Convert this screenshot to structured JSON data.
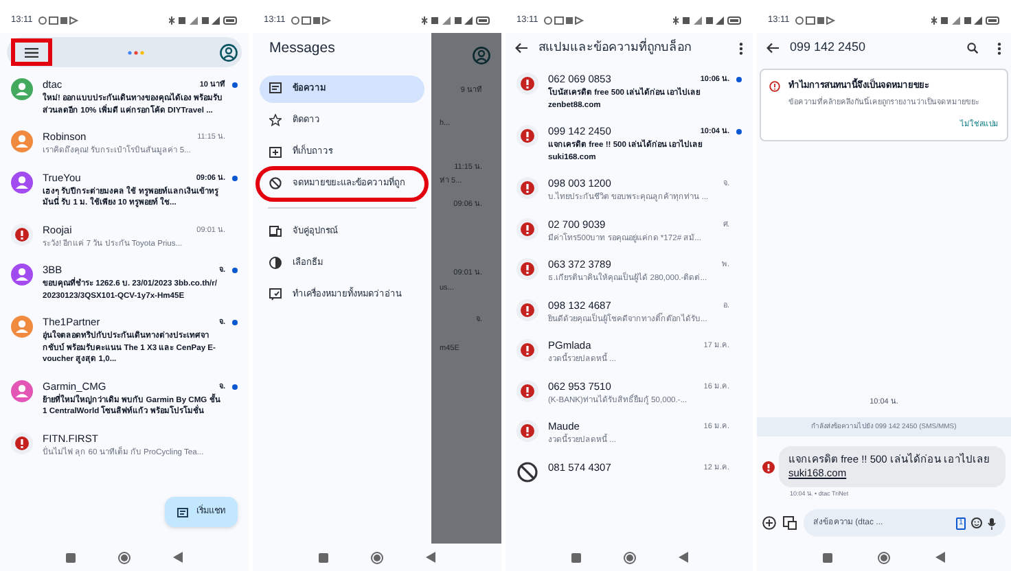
{
  "panels": [
    {
      "kind": "inbox",
      "status_time": "13:11",
      "menu_highlighted": true,
      "conversations": [
        {
          "name": "dtac",
          "preview": "ใหม่! ออกแบบประกันเดินทางของคุณได้เอง พร้อมรับส่วนลดอีก 10% เพิ่มดี แค่กรอกโค้ด DIYTravel ...",
          "time": "10 นาที",
          "unread": true,
          "avatar": {
            "kind": "person",
            "color": "#43a95c"
          }
        },
        {
          "name": "Robinson",
          "preview": "เราคิดถึงคุณ! รับกระเป๋าโรบินสันมูลค่า 5...",
          "time": "11:15 น.",
          "unread": false,
          "avatar": {
            "kind": "person",
            "color": "#f08a3e"
          }
        },
        {
          "name": "TrueYou",
          "preview": "เฮงๆ รับปีกระต่ายมงคล ใช้ ทรูพอยท์แลกเงินเข้าทรูมันนี่ รับ 1 ม. ใช้เพียง 10 ทรูพอยท์ ใช...",
          "time": "09:06 น.",
          "unread": true,
          "avatar": {
            "kind": "person",
            "color": "#a24bf0"
          }
        },
        {
          "name": "Roojai",
          "preview": "ระวัง! อีกแค่ 7 วัน ประกัน Toyota Prius...",
          "time": "09:01 น.",
          "unread": false,
          "avatar": {
            "kind": "spam"
          }
        },
        {
          "name": "3BB",
          "preview": "ขอบคุณที่ชำระ 1262.6 บ. 23/01/2023 3bb.co.th/r/ 20230123/3QSX101-QCV-1y7x-Hm45E",
          "time": "จ.",
          "unread": true,
          "avatar": {
            "kind": "person",
            "color": "#a24bf0"
          }
        },
        {
          "name": "The1Partner",
          "preview": "อุ่นใจตลอดทริปกับประกันเดินทางต่างประเทศจากชับบ์ พร้อมรับคะแนน The 1 X3 และ CenPay E-voucher สูงสุด 1,0...",
          "time": "จ.",
          "unread": true,
          "avatar": {
            "kind": "person",
            "color": "#f08a3e"
          }
        },
        {
          "name": "Garmin_CMG",
          "preview": "ย้ายที่ใหม่ใหญ่กว่าเดิม พบกับ Garmin By CMG ชั้น 1 CentralWorld โซนลิฟท์แก้ว พร้อมโปรโมชั่น",
          "time": "จ.",
          "unread": true,
          "avatar": {
            "kind": "person",
            "color": "#e356b6"
          }
        },
        {
          "name": "FITN.FIRST",
          "preview": "ปั่นไม่ไฟ ลุก 60 นาทีเต็ม กับ ProCycling Tea...",
          "unread": false,
          "avatar": {
            "kind": "spam"
          }
        }
      ],
      "fab": "เริ่มแชท"
    },
    {
      "kind": "drawer",
      "status_time": "13:11",
      "title": "Messages",
      "items": [
        {
          "label": "ข้อความ",
          "selected": true,
          "highlighted": false
        },
        {
          "label": "ติดดาว",
          "selected": false,
          "highlighted": false
        },
        {
          "label": "ที่เก็บถาวร",
          "selected": false,
          "highlighted": false
        },
        {
          "label": "จดหมายขยะและข้อความที่ถูก",
          "selected": false,
          "highlighted": true
        }
      ],
      "more_items": [
        {
          "label": "จับคู่อุปกรณ์"
        },
        {
          "label": "เลือกธีม"
        },
        {
          "label": "ทำเครื่องหมายทั้งหมดว่าอ่าน"
        }
      ],
      "behind": [
        "9 นาที",
        "h...",
        "11:15 น.",
        "ห่า 5...",
        "09:06 น.",
        "09:01 น.",
        "us...",
        "จ.",
        "m45E"
      ]
    },
    {
      "kind": "spam_list",
      "status_time": "13:11",
      "title": "สแปมและข้อความที่ถูกบล็อก",
      "conversations": [
        {
          "name": "062 069 0853",
          "preview": "โบนัสเครดิต free 500 เล่นได้ก่อน เอาไปเลย zenbet88.com",
          "time": "10:06 น.",
          "unread": true,
          "avatar": {
            "kind": "spam"
          }
        },
        {
          "name": "099 142 2450",
          "preview": "แจกเครดิต free !! 500 เล่นได้ก่อน เอาไปเลย suki168.com",
          "time": "10:04 น.",
          "unread": true,
          "avatar": {
            "kind": "spam"
          }
        },
        {
          "name": "098 003 1200",
          "preview": "บ.ไทยประกันชีวิต ขอบพระคุณลูกค้าทุกท่าน ...",
          "time": "จ.",
          "unread": false,
          "avatar": {
            "kind": "spam"
          }
        },
        {
          "name": "02 700 9039",
          "preview": "มีค่าโทร500บาท รอคุณอยู่แค่กด *172# สมั...",
          "time": "ศ.",
          "unread": false,
          "avatar": {
            "kind": "spam"
          }
        },
        {
          "name": "063 372 3789",
          "preview": "ธ.เกียรตินาคินให้คุณเป็นผู้ได้ 280,000.-ติดต่...",
          "time": "พ.",
          "unread": false,
          "avatar": {
            "kind": "spam"
          }
        },
        {
          "name": "098 132 4687",
          "preview": "ยินดีด้วยคุณเป็นผู้โชคดีจากทางติ๊กต๊อกได้รับ...",
          "time": "อ.",
          "unread": false,
          "avatar": {
            "kind": "spam"
          }
        },
        {
          "name": "PGmlada",
          "preview": "งวดนี้รวยปลดหนี้ ...",
          "time": "17 ม.ค.",
          "unread": false,
          "avatar": {
            "kind": "spam"
          }
        },
        {
          "name": "062 953 7510",
          "preview": "(K-BANK)ท่านได้รับสิทธิ์ยืมกู้ 50,000.-...",
          "time": "16 ม.ค.",
          "unread": false,
          "avatar": {
            "kind": "spam"
          }
        },
        {
          "name": "Maude",
          "preview": "งวดนี้รวยปลดหนี้ ...",
          "time": "16 ม.ค.",
          "unread": false,
          "avatar": {
            "kind": "spam"
          }
        },
        {
          "name": "081 574 4307",
          "time": "12 ม.ค.",
          "unread": false,
          "avatar": {
            "kind": "blocked"
          }
        }
      ]
    },
    {
      "kind": "thread",
      "status_time": "13:11",
      "title": "099 142 2450",
      "banner": {
        "title": "ทำไมการสนทนานี้จึงเป็นจดหมายขยะ",
        "body": "ข้อความที่คล้ายคลึงกันนี้เคยถูกรายงานว่าเป็นจดหมายขยะ",
        "action": "ไม่ใช่สแปม"
      },
      "timestamp": "10:04 น.",
      "sending_to": "กำลังส่งข้อความไปยัง 099 142 2450 (SMS/MMS)",
      "message": {
        "text": "แจกเครดิต free !!  500 เล่นได้ก่อน เอาไปเลย",
        "link": "suki168.com",
        "meta": "10:04 น. • dtac TriNet"
      },
      "composer": {
        "placeholder": "ส่งข้อความ (dtac ...",
        "sim": "1"
      }
    }
  ]
}
